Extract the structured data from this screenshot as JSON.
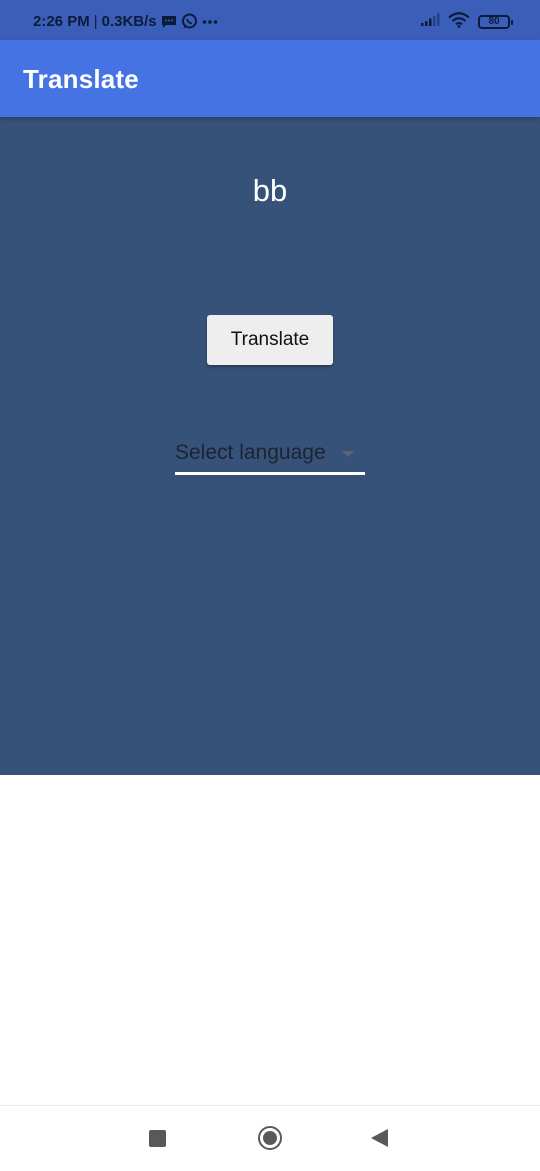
{
  "status_bar": {
    "time": "2:26 PM",
    "separator": "|",
    "network_speed": "0.3KB/s",
    "battery_level": "80",
    "icons": [
      "message-icon",
      "whatsapp-icon",
      "more-dots-icon",
      "signal-icon",
      "wifi-icon",
      "battery-icon"
    ]
  },
  "app_bar": {
    "title": "Translate",
    "color": "#4673e4"
  },
  "main": {
    "background": "#375279",
    "source_text": "bb",
    "translate_button_label": "Translate",
    "language_dropdown_placeholder": "Select language"
  },
  "nav_bar": {
    "icons": [
      "recents-icon",
      "home-icon",
      "back-icon"
    ]
  }
}
